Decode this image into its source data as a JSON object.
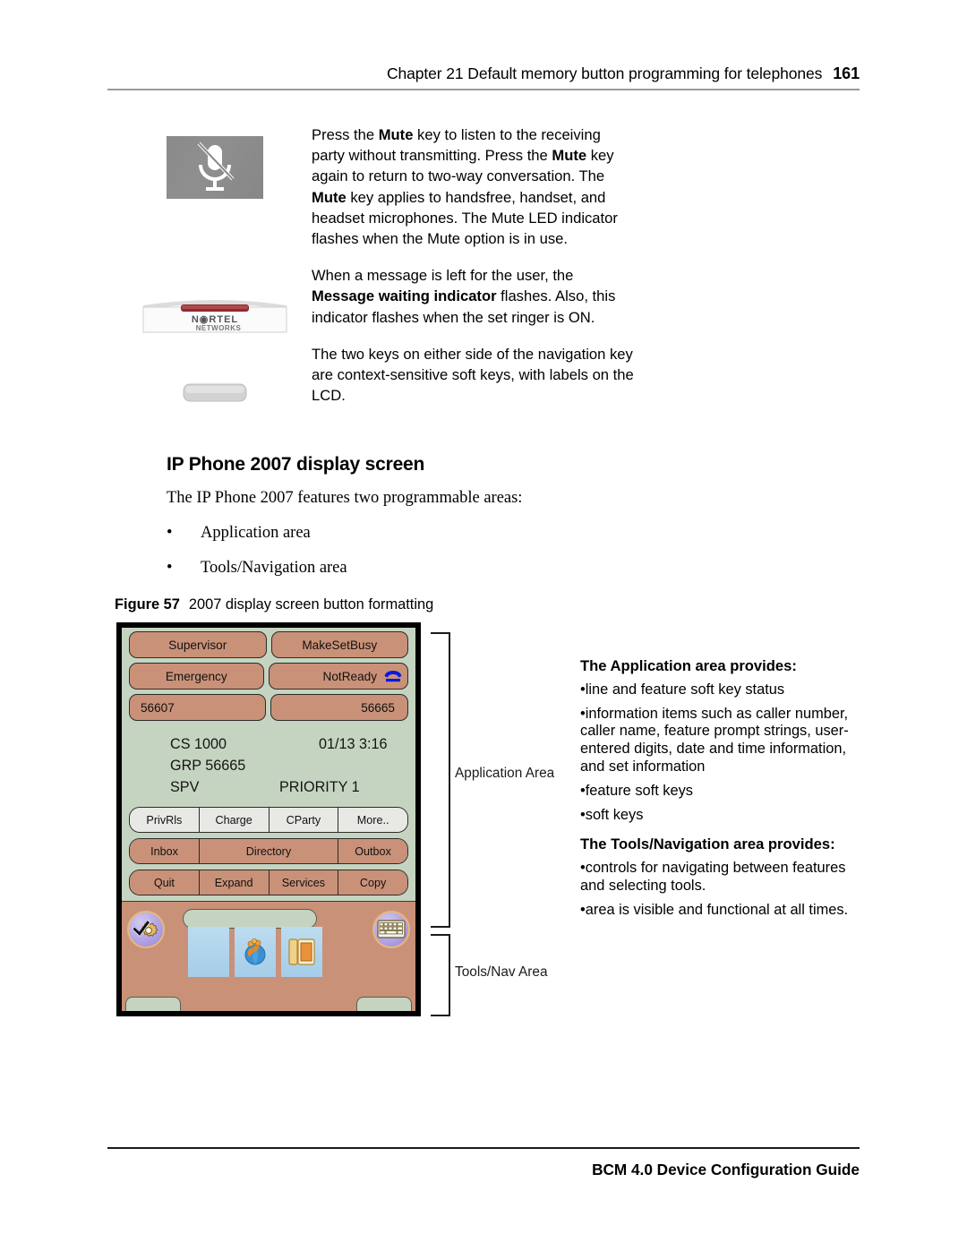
{
  "header": {
    "chapter_line": "Chapter 21  Default memory button programming for telephones",
    "page_number": "161"
  },
  "images": {
    "mute_icon_alt": "mute-microphone-key",
    "phone_top_brand": "NORTEL",
    "phone_top_brand_sub": "NETWORKS",
    "softkey_alt": "soft-key-button"
  },
  "top_text": {
    "p1_a": "Press the ",
    "p1_b1": "Mute",
    "p1_c": " key to listen to the receiving party without transmitting. Press the ",
    "p1_b2": "Mute",
    "p1_d": " key again to return to two-way conversation. The ",
    "p1_b3": "Mute",
    "p1_e": " key applies to handsfree, handset, and headset microphones. The Mute LED indicator flashes when the Mute option is in use.",
    "p2_a": "When a message is left for the user, the ",
    "p2_b": "Message waiting indicator",
    "p2_c": " flashes. Also, this indicator flashes when the set ringer is ON.",
    "p3": "The two keys on either side of the navigation key are context-sensitive soft keys, with labels on the LCD."
  },
  "section": {
    "heading": "IP Phone 2007 display screen",
    "intro": "The IP Phone 2007 features two programmable areas:",
    "bullets": [
      {
        "dot": "•",
        "label": "Application area"
      },
      {
        "dot": "•",
        "label": "Tools/Navigation area"
      }
    ]
  },
  "figure": {
    "label": "Figure 57",
    "caption": "2007 display screen button formatting",
    "colors": {
      "lcd_background": "#c5d4c0",
      "feature_key": "#c99178",
      "soft_key_light": "#e8e8e5",
      "bezel": "#000000",
      "tel_icon": "#0a1ae0"
    },
    "feature_keys": [
      {
        "left": "Supervisor",
        "right": "MakeSetBusy",
        "right_icon": ""
      },
      {
        "left": "Emergency",
        "right": "NotReady",
        "right_icon": "telephone-icon"
      },
      {
        "left": "56607",
        "right": "56665",
        "right_icon": ""
      }
    ],
    "info_lines": [
      {
        "col1": "CS 1000",
        "col2": "01/13   3:16"
      },
      {
        "col1": "GRP 56665",
        "col2": ""
      },
      {
        "col1": "SPV",
        "col3": "PRIORITY  1"
      }
    ],
    "softkey_rows": [
      {
        "style": "light",
        "keys": [
          "PrivRls",
          "Charge",
          "CParty",
          "More.."
        ]
      },
      {
        "style": "tan",
        "keys": [
          "Inbox",
          "Directory",
          "Outbox"
        ]
      },
      {
        "style": "tan",
        "keys": [
          "Quit",
          "Expand",
          "Services",
          "Copy"
        ]
      }
    ],
    "tools_nav": {
      "left_icon": "settings-gear-check-icon",
      "right_icon": "keyboard-icon",
      "tiles": [
        "blank-tile",
        "world-globe-icon",
        "phone-directory-icon"
      ]
    },
    "annotations": [
      {
        "name": "application-area",
        "label": "Application Area"
      },
      {
        "name": "tools-nav-area",
        "label": "Tools/Nav Area"
      }
    ]
  },
  "descriptions": {
    "app_heading": "The Application area provides:",
    "app_bullets": [
      "line and feature soft key status",
      "information items such as caller number, caller name, feature prompt strings, user-entered digits, date and time information, and set information",
      "feature soft keys",
      "soft keys"
    ],
    "tools_heading": "The Tools/Navigation area provides:",
    "tools_bullets": [
      "controls for navigating between features and selecting tools.",
      "area is visible and functional at all times."
    ]
  },
  "footer": {
    "text": "BCM 4.0 Device Configuration Guide"
  }
}
